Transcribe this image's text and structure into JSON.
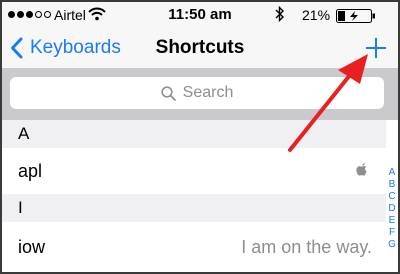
{
  "status_bar": {
    "carrier": "Airtel",
    "time": "11:50 am",
    "battery_percent": "21%",
    "icons": [
      "signal-dots-icon",
      "wifi-icon",
      "bluetooth-icon",
      "battery-charging-icon"
    ]
  },
  "nav_bar": {
    "back_label": "Keyboards",
    "title": "Shortcuts",
    "add_icon": "plus-icon"
  },
  "search": {
    "placeholder": "Search"
  },
  "sections": [
    {
      "letter": "A",
      "rows": [
        {
          "phrase": "apl",
          "shortcut_icon": "apple-logo-icon"
        }
      ]
    },
    {
      "letter": "I",
      "rows": [
        {
          "phrase": "iow",
          "expansion": "I am on the way."
        }
      ]
    }
  ],
  "index": [
    "A",
    "B",
    "C",
    "D",
    "E",
    "F",
    "G"
  ],
  "colors": {
    "accent": "#1a7cf4",
    "annotation": "#e8201f",
    "bar_background": "#f7f7f8",
    "section_background": "#efeff4"
  }
}
